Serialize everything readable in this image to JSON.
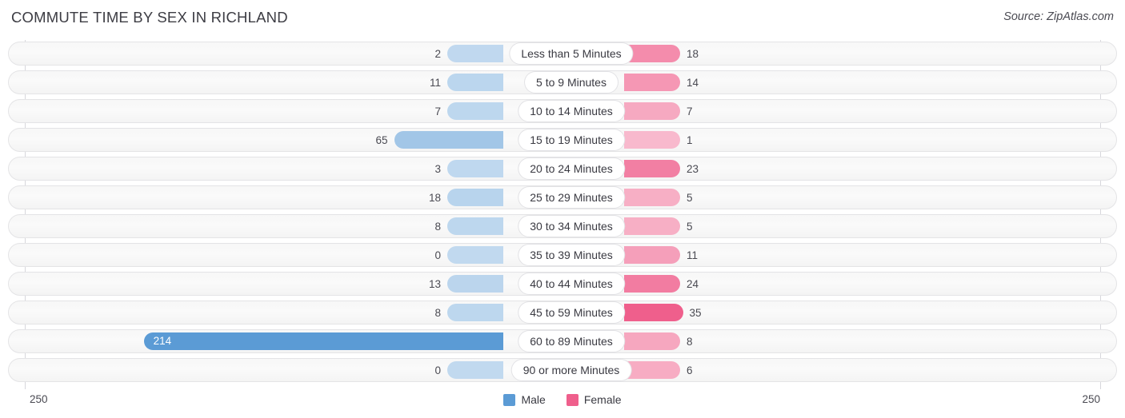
{
  "header": {
    "title": "COMMUTE TIME BY SEX IN RICHLAND",
    "source": "Source: ZipAtlas.com"
  },
  "legend": {
    "male_label": "Male",
    "female_label": "Female",
    "male_color": "#5b9bd5",
    "female_color": "#ef5f8c"
  },
  "axis": {
    "left_tick": "250",
    "right_tick": "250",
    "max": 250
  },
  "chart_data": {
    "type": "bar",
    "title": "COMMUTE TIME BY SEX IN RICHLAND",
    "subtitle": "Source: ZipAtlas.com",
    "orientation": "horizontal-diverging",
    "xlabel": "",
    "ylabel": "",
    "xlim": [
      250,
      250
    ],
    "grid": false,
    "legend_position": "bottom-center",
    "categories": [
      "Less than 5 Minutes",
      "5 to 9 Minutes",
      "10 to 14 Minutes",
      "15 to 19 Minutes",
      "20 to 24 Minutes",
      "25 to 29 Minutes",
      "30 to 34 Minutes",
      "35 to 39 Minutes",
      "40 to 44 Minutes",
      "45 to 59 Minutes",
      "60 to 89 Minutes",
      "90 or more Minutes"
    ],
    "series": [
      {
        "name": "Male",
        "color": "#5b9bd5",
        "side": "left",
        "values": [
          2,
          11,
          7,
          65,
          3,
          18,
          8,
          0,
          13,
          8,
          214,
          0
        ]
      },
      {
        "name": "Female",
        "color": "#ef5f8c",
        "side": "right",
        "values": [
          18,
          14,
          7,
          1,
          23,
          5,
          5,
          11,
          24,
          35,
          8,
          6
        ]
      }
    ]
  }
}
